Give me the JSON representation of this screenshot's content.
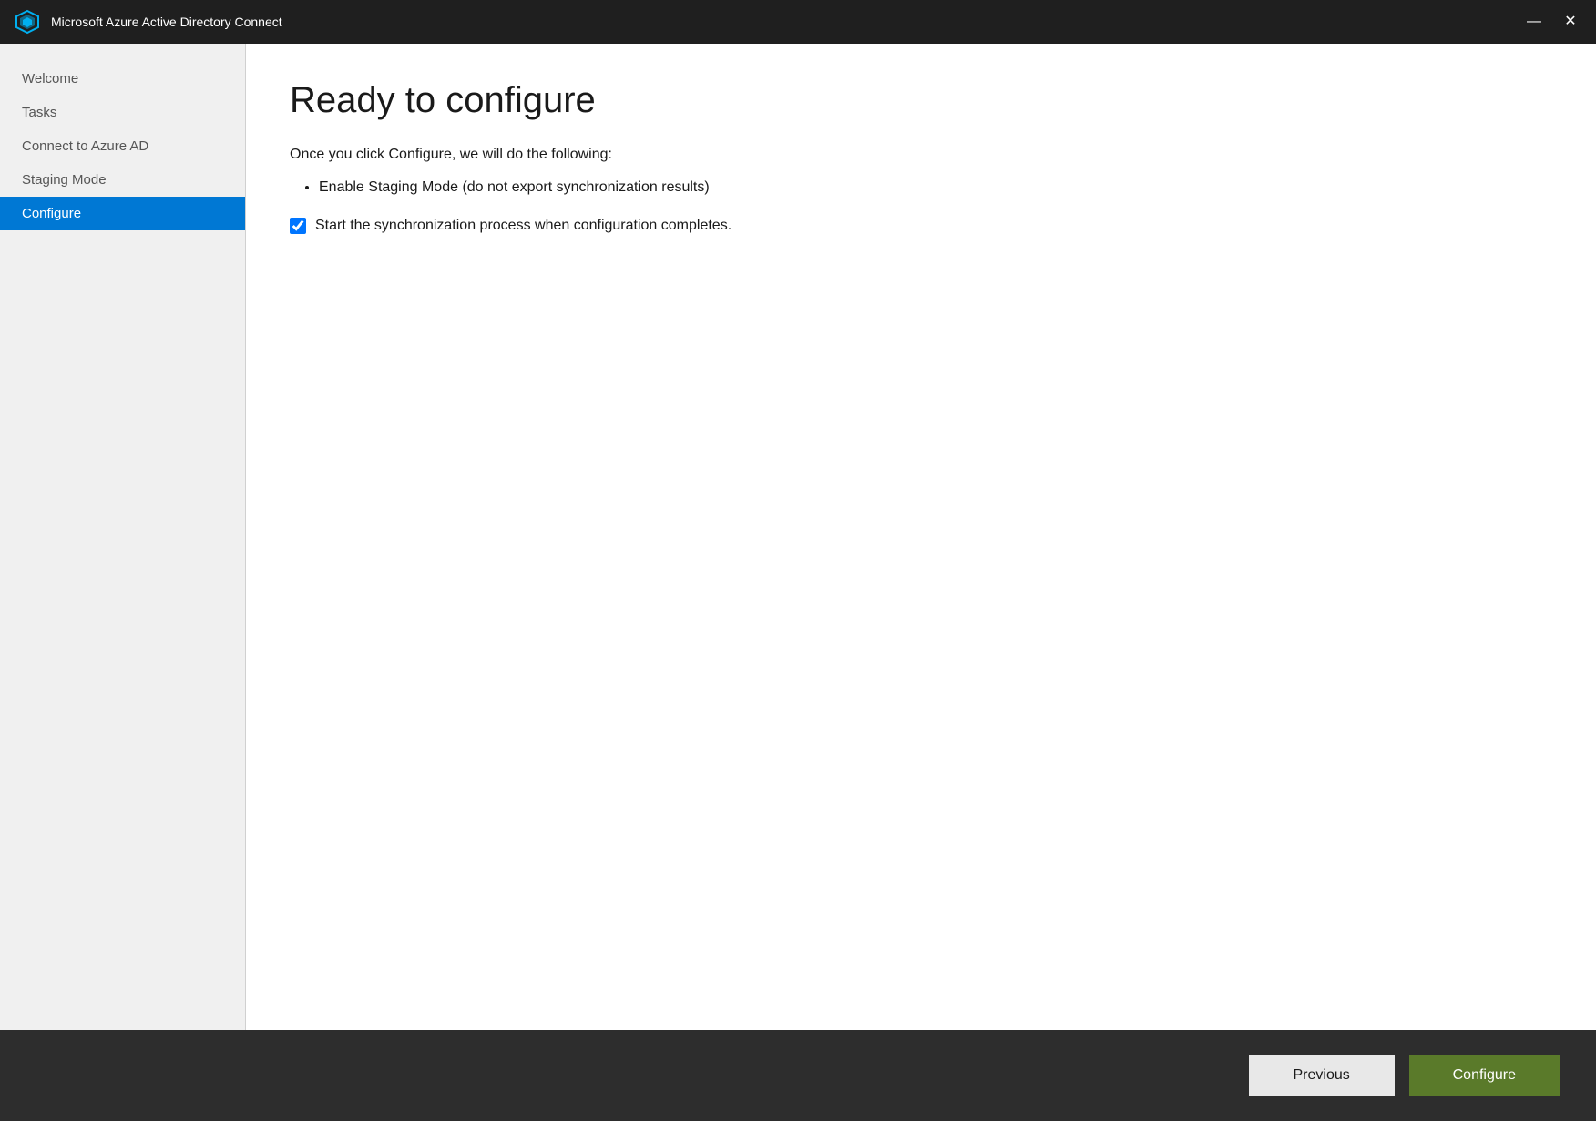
{
  "titleBar": {
    "title": "Microsoft Azure Active Directory Connect",
    "minimizeLabel": "—",
    "closeLabel": "✕"
  },
  "sidebar": {
    "items": [
      {
        "id": "welcome",
        "label": "Welcome",
        "active": false
      },
      {
        "id": "tasks",
        "label": "Tasks",
        "active": false
      },
      {
        "id": "connect-azure-ad",
        "label": "Connect to Azure AD",
        "active": false
      },
      {
        "id": "staging-mode",
        "label": "Staging Mode",
        "active": false
      },
      {
        "id": "configure",
        "label": "Configure",
        "active": true
      }
    ]
  },
  "main": {
    "pageTitle": "Ready to configure",
    "descriptionText": "Once you click Configure, we will do the following:",
    "bulletItems": [
      "Enable Staging Mode (do not export synchronization results)"
    ],
    "checkbox": {
      "label": "Start the synchronization process when configuration completes.",
      "checked": true
    }
  },
  "footer": {
    "previousLabel": "Previous",
    "configureLabel": "Configure"
  }
}
